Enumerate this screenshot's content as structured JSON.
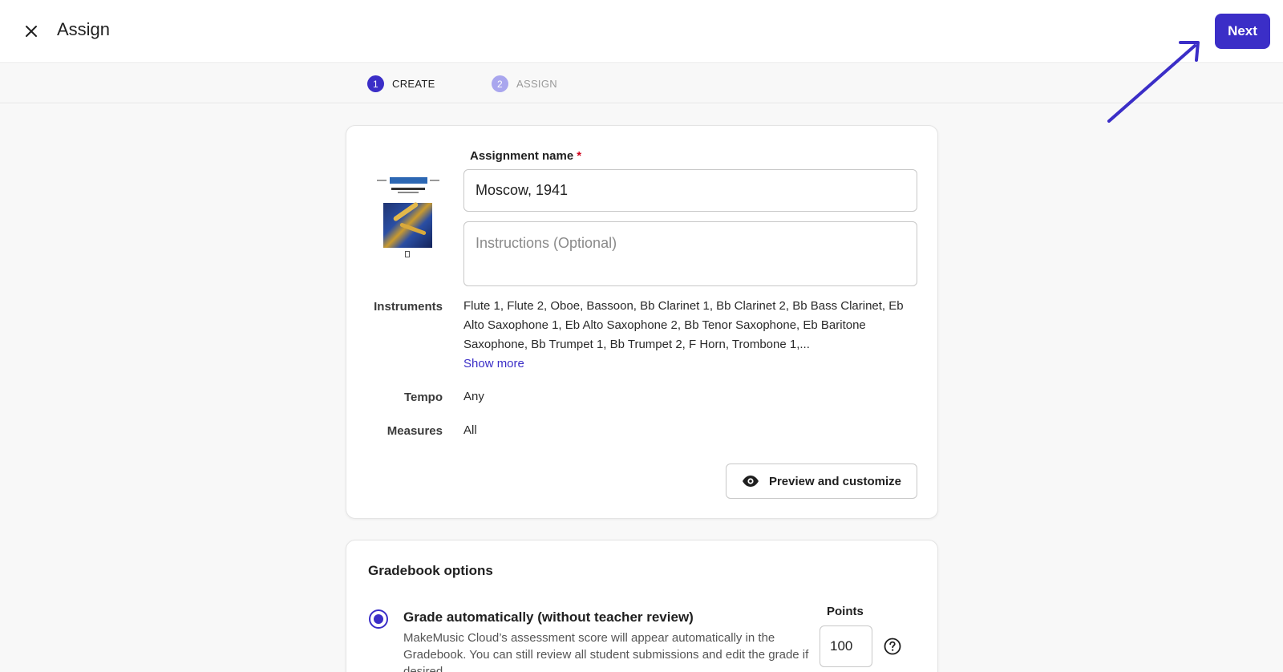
{
  "header": {
    "title": "Assign",
    "next_label": "Next"
  },
  "steps": [
    {
      "number": "1",
      "label": "CREATE"
    },
    {
      "number": "2",
      "label": "ASSIGN"
    }
  ],
  "assignment": {
    "name_label": "Assignment name",
    "required_mark": "*",
    "name_value": "Moscow, 1941",
    "instructions_placeholder": "Instructions (Optional)",
    "instruments_label": "Instruments",
    "instruments_value": "Flute 1, Flute 2, Oboe, Bassoon, Bb Clarinet 1, Bb Clarinet 2, Bb Bass Clarinet, Eb Alto Saxophone 1, Eb Alto Saxophone 2, Bb Tenor Saxophone, Eb Baritone Saxophone, Bb Trumpet 1, Bb Trumpet 2, F Horn, Trombone 1,...",
    "show_more_label": "Show more",
    "tempo_label": "Tempo",
    "tempo_value": "Any",
    "measures_label": "Measures",
    "measures_value": "All",
    "preview_label": "Preview and customize"
  },
  "gradebook": {
    "title": "Gradebook options",
    "option_title": "Grade automatically (without teacher review)",
    "option_desc": "MakeMusic Cloud’s assessment score will appear automatically in the Gradebook. You can still review all student submissions and edit the grade if desired.",
    "points_label": "Points",
    "points_value": "100"
  },
  "colors": {
    "accent": "#3b2ec7",
    "step_inactive": "#a9a6ee",
    "required": "#d0021b"
  },
  "icons": {
    "close": "close-icon",
    "preview": "eye-icon",
    "help": "help-circle-icon",
    "annotation": "arrow-annotation"
  }
}
